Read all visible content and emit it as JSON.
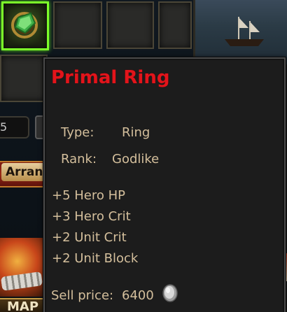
{
  "inventory": {
    "quantity_value": "5",
    "arrange_label": "Arrang",
    "map_label": "MAP"
  },
  "tooltip": {
    "item_name": "Primal Ring",
    "type_label": "Type:",
    "type_value": "Ring",
    "rank_label": "Rank:",
    "rank_value": "Godlike",
    "stats": [
      "+5 Hero HP",
      "+3 Hero Crit",
      "+2 Unit Crit",
      "+2 Unit Block"
    ],
    "sell_label": "Sell price:",
    "sell_value": "6400",
    "currency_icon": "silver-coin-icon"
  },
  "colors": {
    "item_name": "#e2141b",
    "body_text": "#d4bf9c",
    "selected_slot_border": "#7dff2a"
  }
}
